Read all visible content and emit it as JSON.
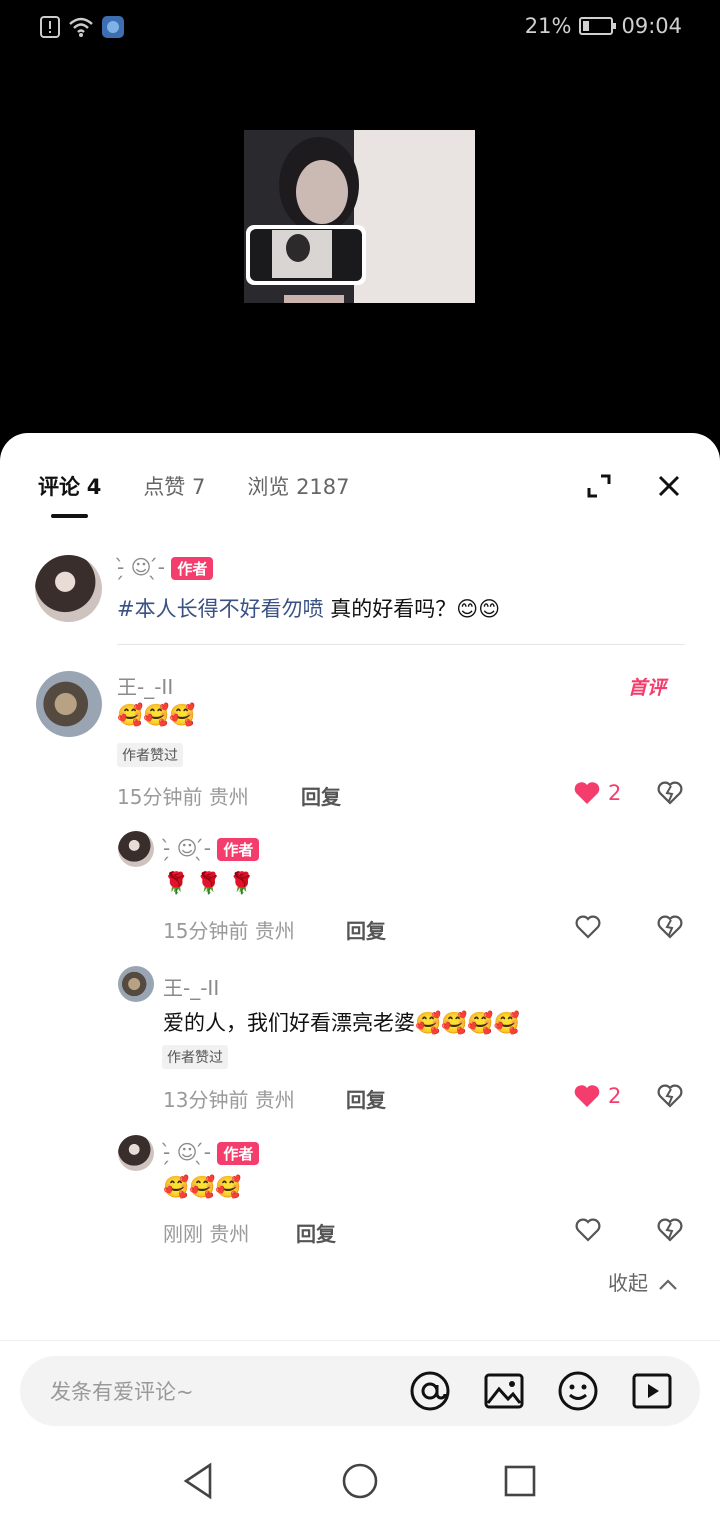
{
  "status": {
    "battery_pct": "21%",
    "time": "09:04"
  },
  "tabs": [
    {
      "label": "评论",
      "count": "4"
    },
    {
      "label": "点赞",
      "count": "7"
    },
    {
      "label": "浏览",
      "count": "2187"
    }
  ],
  "post": {
    "author": "-̗̀ ☺︎ ̖́-",
    "author_badge": "作者",
    "hashtag": "#本人长得不好看勿喷",
    "text": "真的好看吗？😊😊"
  },
  "comments": [
    {
      "user": "王-_-II",
      "tag": "首评",
      "text": "🥰🥰🥰",
      "liked_by_author": "作者赞过",
      "time": "15分钟前",
      "location": "贵州",
      "reply_label": "回复",
      "likes": "2"
    },
    {
      "user": "-̗̀ ☺︎ ̖́-",
      "badge": "作者",
      "text": "🌹 🌹 🌹",
      "time": "15分钟前",
      "location": "贵州",
      "reply_label": "回复"
    },
    {
      "user": "王-_-II",
      "text": "爱的人，我们好看漂亮老婆🥰🥰🥰🥰",
      "liked_by_author": "作者赞过",
      "time": "13分钟前",
      "location": "贵州",
      "reply_label": "回复",
      "likes": "2"
    },
    {
      "user": "-̗̀ ☺︎ ̖́-",
      "badge": "作者",
      "text": "🥰🥰🥰",
      "time": "刚刚",
      "location": "贵州",
      "reply_label": "回复"
    }
  ],
  "collapse_label": "收起",
  "input": {
    "placeholder": "发条有爱评论~"
  },
  "colors": {
    "accent": "#f43d6c",
    "hashtag": "#3a5184"
  },
  "icons": [
    "alert-icon",
    "wifi-icon",
    "app-icon",
    "battery-icon",
    "expand-icon",
    "close-icon",
    "heart-icon",
    "dislike-heart-icon",
    "at-icon",
    "image-icon",
    "emoji-icon",
    "play-icon",
    "back-nav-icon",
    "home-nav-icon",
    "recent-nav-icon",
    "chevron-up-icon"
  ]
}
